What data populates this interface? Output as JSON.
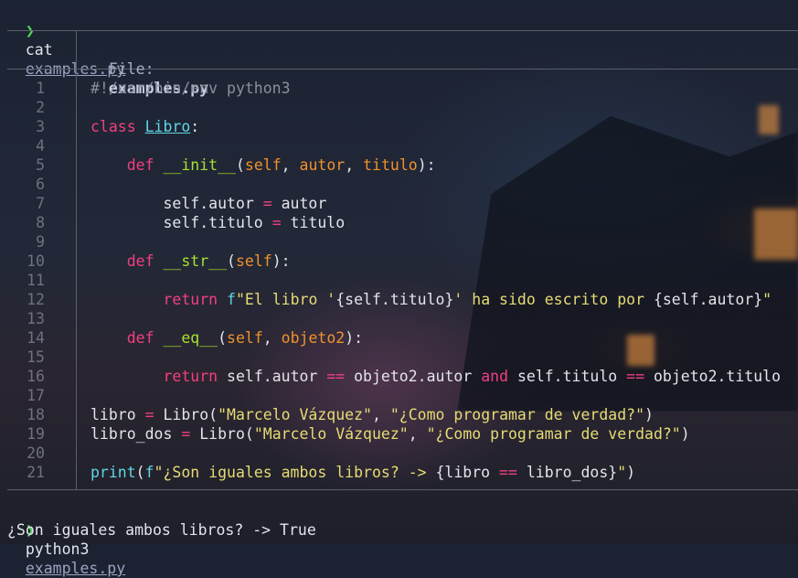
{
  "terminal": {
    "prompt_symbol": "❯",
    "command1": {
      "cmd": "cat",
      "arg": "examples.py"
    },
    "header": {
      "label": "File:",
      "filename": "examples.py"
    },
    "code_lines": [
      {
        "n": "1",
        "tokens": [
          {
            "t": "#!/usr/bin/env python3",
            "c": "cmt"
          }
        ]
      },
      {
        "n": "2",
        "tokens": []
      },
      {
        "n": "3",
        "tokens": [
          {
            "t": "class ",
            "c": "kw"
          },
          {
            "t": "Libro",
            "c": "cls"
          },
          {
            "t": ":",
            "c": "plain"
          }
        ]
      },
      {
        "n": "4",
        "tokens": []
      },
      {
        "n": "5",
        "tokens": [
          {
            "t": "    ",
            "c": "plain"
          },
          {
            "t": "def ",
            "c": "kw"
          },
          {
            "t": "__init__",
            "c": "fn"
          },
          {
            "t": "(",
            "c": "plain"
          },
          {
            "t": "self",
            "c": "param"
          },
          {
            "t": ", ",
            "c": "plain"
          },
          {
            "t": "autor",
            "c": "param"
          },
          {
            "t": ", ",
            "c": "plain"
          },
          {
            "t": "titulo",
            "c": "param"
          },
          {
            "t": "):",
            "c": "plain"
          }
        ]
      },
      {
        "n": "6",
        "tokens": []
      },
      {
        "n": "7",
        "tokens": [
          {
            "t": "        self.autor ",
            "c": "plain"
          },
          {
            "t": "=",
            "c": "op"
          },
          {
            "t": " autor",
            "c": "plain"
          }
        ]
      },
      {
        "n": "8",
        "tokens": [
          {
            "t": "        self.titulo ",
            "c": "plain"
          },
          {
            "t": "=",
            "c": "op"
          },
          {
            "t": " titulo",
            "c": "plain"
          }
        ]
      },
      {
        "n": "9",
        "tokens": []
      },
      {
        "n": "10",
        "tokens": [
          {
            "t": "    ",
            "c": "plain"
          },
          {
            "t": "def ",
            "c": "kw"
          },
          {
            "t": "__str__",
            "c": "fn"
          },
          {
            "t": "(",
            "c": "plain"
          },
          {
            "t": "self",
            "c": "param"
          },
          {
            "t": "):",
            "c": "plain"
          }
        ]
      },
      {
        "n": "11",
        "tokens": []
      },
      {
        "n": "12",
        "tokens": [
          {
            "t": "        ",
            "c": "plain"
          },
          {
            "t": "return ",
            "c": "kw"
          },
          {
            "t": "f",
            "c": "bi"
          },
          {
            "t": "\"El libro '",
            "c": "str"
          },
          {
            "t": "{self.titulo}",
            "c": "plain"
          },
          {
            "t": "' ha sido escrito por ",
            "c": "str"
          },
          {
            "t": "{self.autor}",
            "c": "plain"
          },
          {
            "t": "\"",
            "c": "str"
          }
        ]
      },
      {
        "n": "13",
        "tokens": []
      },
      {
        "n": "14",
        "tokens": [
          {
            "t": "    ",
            "c": "plain"
          },
          {
            "t": "def ",
            "c": "kw"
          },
          {
            "t": "__eq__",
            "c": "fn"
          },
          {
            "t": "(",
            "c": "plain"
          },
          {
            "t": "self",
            "c": "param"
          },
          {
            "t": ", ",
            "c": "plain"
          },
          {
            "t": "objeto2",
            "c": "param"
          },
          {
            "t": "):",
            "c": "plain"
          }
        ]
      },
      {
        "n": "15",
        "tokens": []
      },
      {
        "n": "16",
        "tokens": [
          {
            "t": "        ",
            "c": "plain"
          },
          {
            "t": "return ",
            "c": "kw"
          },
          {
            "t": "self.autor ",
            "c": "plain"
          },
          {
            "t": "==",
            "c": "op"
          },
          {
            "t": " objeto2.autor ",
            "c": "plain"
          },
          {
            "t": "and",
            "c": "kw"
          },
          {
            "t": " self.titulo ",
            "c": "plain"
          },
          {
            "t": "==",
            "c": "op"
          },
          {
            "t": " objeto2.titulo",
            "c": "plain"
          }
        ]
      },
      {
        "n": "17",
        "tokens": []
      },
      {
        "n": "18",
        "tokens": [
          {
            "t": "libro ",
            "c": "plain"
          },
          {
            "t": "=",
            "c": "op"
          },
          {
            "t": " Libro(",
            "c": "plain"
          },
          {
            "t": "\"Marcelo Vázquez\"",
            "c": "str"
          },
          {
            "t": ", ",
            "c": "plain"
          },
          {
            "t": "\"¿Como programar de verdad?\"",
            "c": "str"
          },
          {
            "t": ")",
            "c": "plain"
          }
        ]
      },
      {
        "n": "19",
        "tokens": [
          {
            "t": "libro_dos ",
            "c": "plain"
          },
          {
            "t": "=",
            "c": "op"
          },
          {
            "t": " Libro(",
            "c": "plain"
          },
          {
            "t": "\"Marcelo Vázquez\"",
            "c": "str"
          },
          {
            "t": ", ",
            "c": "plain"
          },
          {
            "t": "\"¿Como programar de verdad?\"",
            "c": "str"
          },
          {
            "t": ")",
            "c": "plain"
          }
        ]
      },
      {
        "n": "20",
        "tokens": []
      },
      {
        "n": "21",
        "tokens": [
          {
            "t": "print",
            "c": "bi"
          },
          {
            "t": "(",
            "c": "plain"
          },
          {
            "t": "f",
            "c": "bi"
          },
          {
            "t": "\"¿Son iguales ambos libros? -> ",
            "c": "str"
          },
          {
            "t": "{libro ",
            "c": "plain"
          },
          {
            "t": "==",
            "c": "op"
          },
          {
            "t": " libro_dos}",
            "c": "plain"
          },
          {
            "t": "\"",
            "c": "str"
          },
          {
            "t": ")",
            "c": "plain"
          }
        ]
      }
    ],
    "command2": {
      "cmd": "python3",
      "arg": "examples.py"
    },
    "output": "¿Son iguales ambos libros? -> True"
  },
  "colors": {
    "prompt": "#4fd65a",
    "keyword": "#f0407f",
    "string": "#e6db74",
    "param": "#f0922b",
    "function": "#a6e22e",
    "class": "#5fd6e6",
    "comment": "#8a8f9c"
  }
}
